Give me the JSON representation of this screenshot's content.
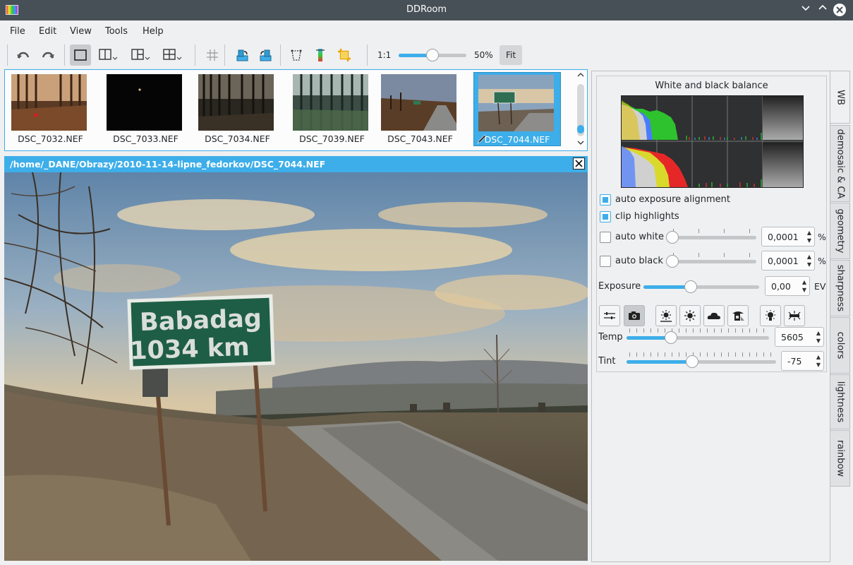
{
  "window": {
    "title": "DDRoom"
  },
  "menu": [
    "File",
    "Edit",
    "View",
    "Tools",
    "Help"
  ],
  "toolbar": {
    "zoom_one": "1:1",
    "zoom_percent": "50%",
    "zoom_level": 0.5,
    "fit_label": "Fit"
  },
  "filmstrip": [
    {
      "name": "DSC_7032.NEF",
      "selected": false
    },
    {
      "name": "DSC_7033.NEF",
      "selected": false
    },
    {
      "name": "DSC_7034.NEF",
      "selected": false
    },
    {
      "name": "DSC_7039.NEF",
      "selected": false
    },
    {
      "name": "DSC_7043.NEF",
      "selected": false
    },
    {
      "name": "DSC_7044.NEF",
      "selected": true
    }
  ],
  "viewer": {
    "path": "/home/_DANE/Obrazy/2010-11-14-lipne_fedorkov/DSC_7044.NEF",
    "sign_line1": "Babadag",
    "sign_line2": "1034 km"
  },
  "panel": {
    "histogram_title": "White and black balance",
    "auto_exposure_alignment": {
      "label": "auto exposure alignment",
      "checked": true
    },
    "clip_highlights": {
      "label": "clip highlights",
      "checked": true
    },
    "auto_white": {
      "label": "auto white",
      "checked": false,
      "value": "0,0001",
      "unit": "%"
    },
    "auto_black": {
      "label": "auto black",
      "checked": false,
      "value": "0,0001",
      "unit": "%"
    },
    "exposure": {
      "label": "Exposure",
      "value": "0,00",
      "unit": "EV"
    },
    "temp": {
      "label": "Temp",
      "value": "5605"
    },
    "tint": {
      "label": "Tint",
      "value": "-75"
    }
  },
  "tabs": [
    "WB",
    "demosaic & CA",
    "geometry",
    "sharpness",
    "colors",
    "lightness",
    "rainbow"
  ]
}
